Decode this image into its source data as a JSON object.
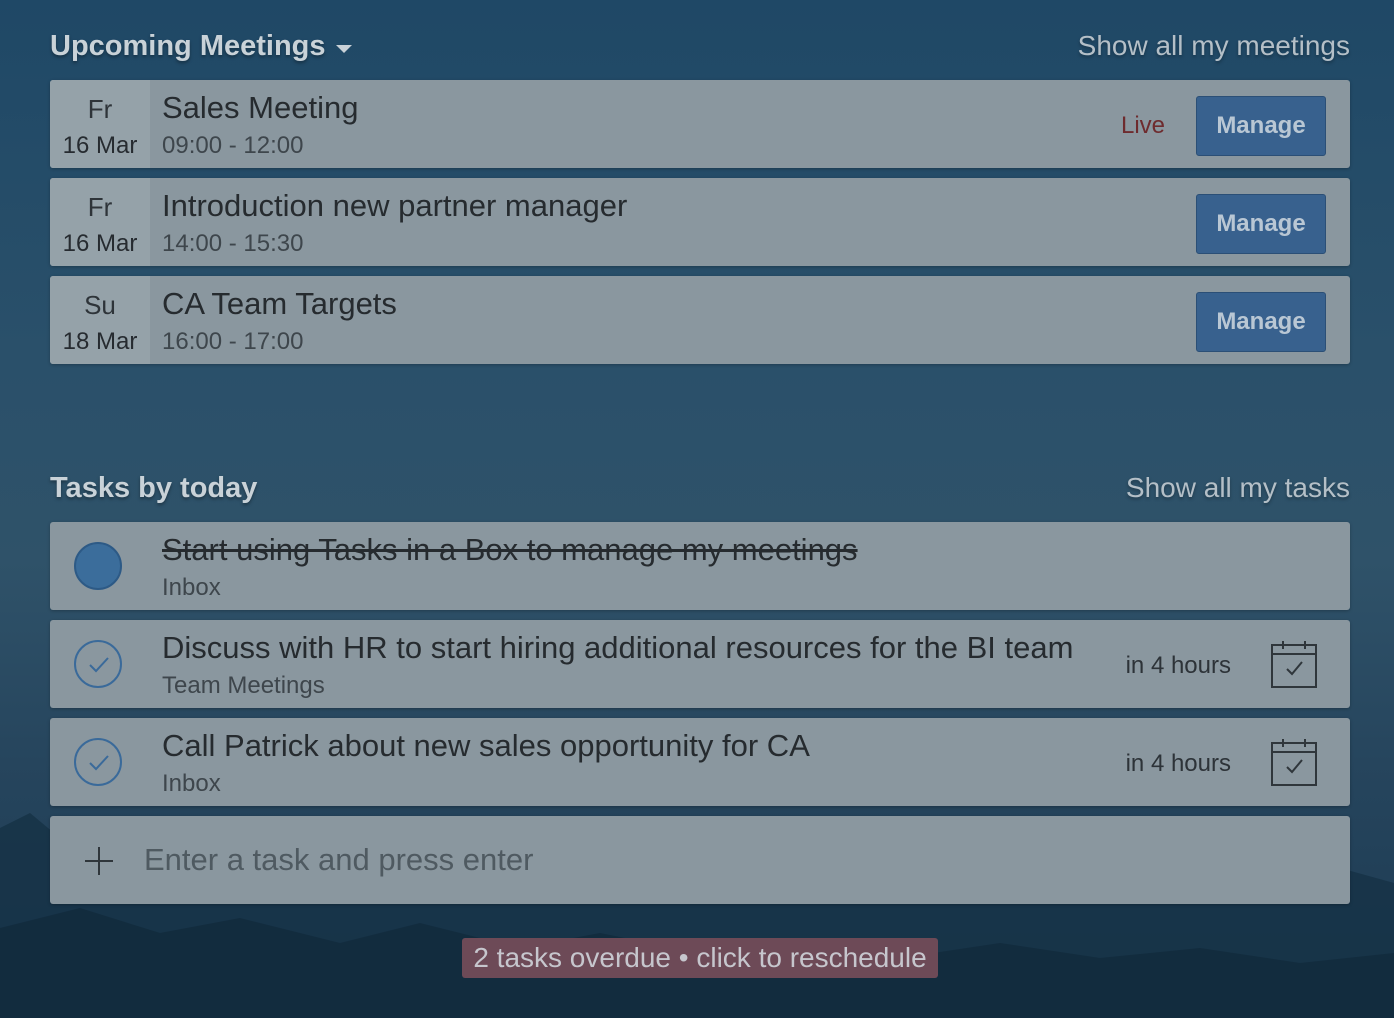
{
  "meetings": {
    "title": "Upcoming Meetings",
    "show_all_label": "Show all my meetings",
    "items": [
      {
        "day": "Fr",
        "date": "16 Mar",
        "title": "Sales Meeting",
        "time": "09:00 - 12:00",
        "status": "Live",
        "button": "Manage"
      },
      {
        "day": "Fr",
        "date": "16 Mar",
        "title": "Introduction new partner manager",
        "time": "14:00 - 15:30",
        "button": "Manage"
      },
      {
        "day": "Su",
        "date": "18 Mar",
        "title": "CA Team Targets",
        "time": "16:00 - 17:00",
        "button": "Manage"
      }
    ]
  },
  "tasks": {
    "title": "Tasks by today",
    "show_all_label": "Show all my tasks",
    "items": [
      {
        "title": "Start using Tasks in a Box to manage my meetings",
        "list": "Inbox",
        "completed": true
      },
      {
        "title": "Discuss with HR to start hiring additional resources for the BI team",
        "list": "Team Meetings",
        "due": "in 4 hours",
        "completed": false
      },
      {
        "title": "Call Patrick about new sales opportunity for CA",
        "list": "Inbox",
        "due": "in 4 hours",
        "completed": false
      }
    ],
    "add_placeholder": "Enter a task and press enter"
  },
  "overdue_banner": "2 tasks overdue • click to reschedule",
  "colors": {
    "accent": "#38618e",
    "live": "#6e2b2e",
    "card": "#8a979f",
    "overdue_bg": "#6d4a57"
  },
  "icons": [
    "caret-down-icon",
    "check-circle-icon",
    "calendar-check-icon",
    "plus-icon"
  ]
}
